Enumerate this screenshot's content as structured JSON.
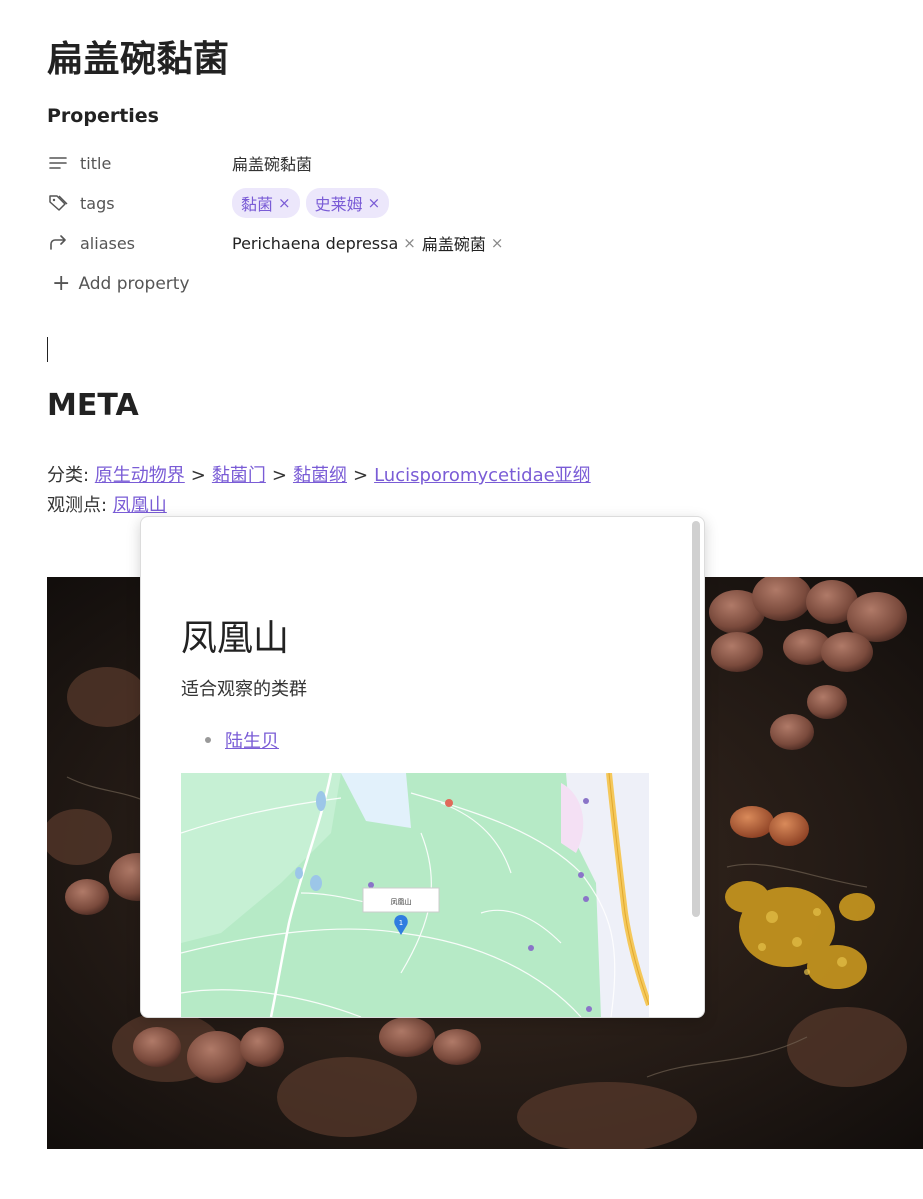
{
  "note": {
    "title": "扁盖碗黏菌",
    "properties_heading": "Properties",
    "properties": [
      {
        "icon": "text-lines-icon",
        "key": "title",
        "value": "扁盖碗黏菌"
      },
      {
        "icon": "tags-icon",
        "key": "tags",
        "tags": [
          "黏菌",
          "史莱姆"
        ]
      },
      {
        "icon": "arrow-forward-icon",
        "key": "aliases",
        "aliases": [
          "Perichaena depressa",
          "扁盖碗菌"
        ]
      }
    ],
    "add_property_label": "Add property",
    "remove_glyph": "×",
    "meta_heading": "META",
    "classification_label": "分类: ",
    "classification": [
      "原生动物界",
      "黏菌门",
      "黏菌纲",
      "Lucisporomycetidae亚纲"
    ],
    "classification_sep": ">",
    "observation_label": "观测点: ",
    "observation_link": "凤凰山"
  },
  "popover": {
    "title": "凤凰山",
    "subtitle": "适合观察的类群",
    "items": [
      "陆生贝"
    ],
    "map": {
      "marker_label": "凤凰山",
      "marker_number": "1"
    }
  },
  "colors": {
    "accent": "#7a5cd6",
    "tag_bg": "#ece7fb",
    "map_green": "#b6eac6",
    "road_yellow": "#f5c85a"
  }
}
